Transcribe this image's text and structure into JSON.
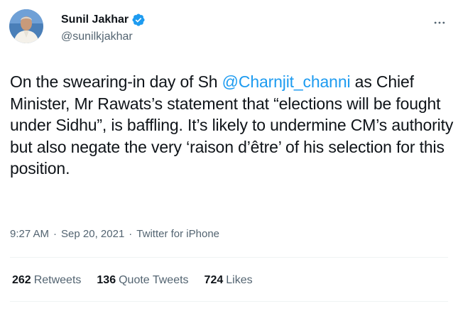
{
  "author": {
    "name": "Sunil Jakhar",
    "handle": "@sunilkjakhar",
    "verified": true
  },
  "tweet": {
    "text_before_mention": "On the swearing-in day of Sh ",
    "mention": "@Charnjit_channi",
    "text_after_mention": " as Chief Minister, Mr Rawats’s statement that “elections will be fought under Sidhu”, is baffling. It’s likely to undermine CM’s authority but also negate the very ‘raison d’être’ of his selection for this position."
  },
  "meta": {
    "time": "9:27 AM",
    "separator": "·",
    "date": "Sep 20, 2021",
    "source": "Twitter for iPhone"
  },
  "stats": {
    "retweets_count": "262",
    "retweets_label": "Retweets",
    "quote_tweets_count": "136",
    "quote_tweets_label": "Quote Tweets",
    "likes_count": "724",
    "likes_label": "Likes"
  },
  "colors": {
    "accent": "#1d9bf0",
    "text_primary": "#0f1419",
    "text_secondary": "#536471",
    "divider": "#eff3f4"
  },
  "icons": {
    "verified": "verified-badge-icon",
    "more": "more-options-icon"
  }
}
